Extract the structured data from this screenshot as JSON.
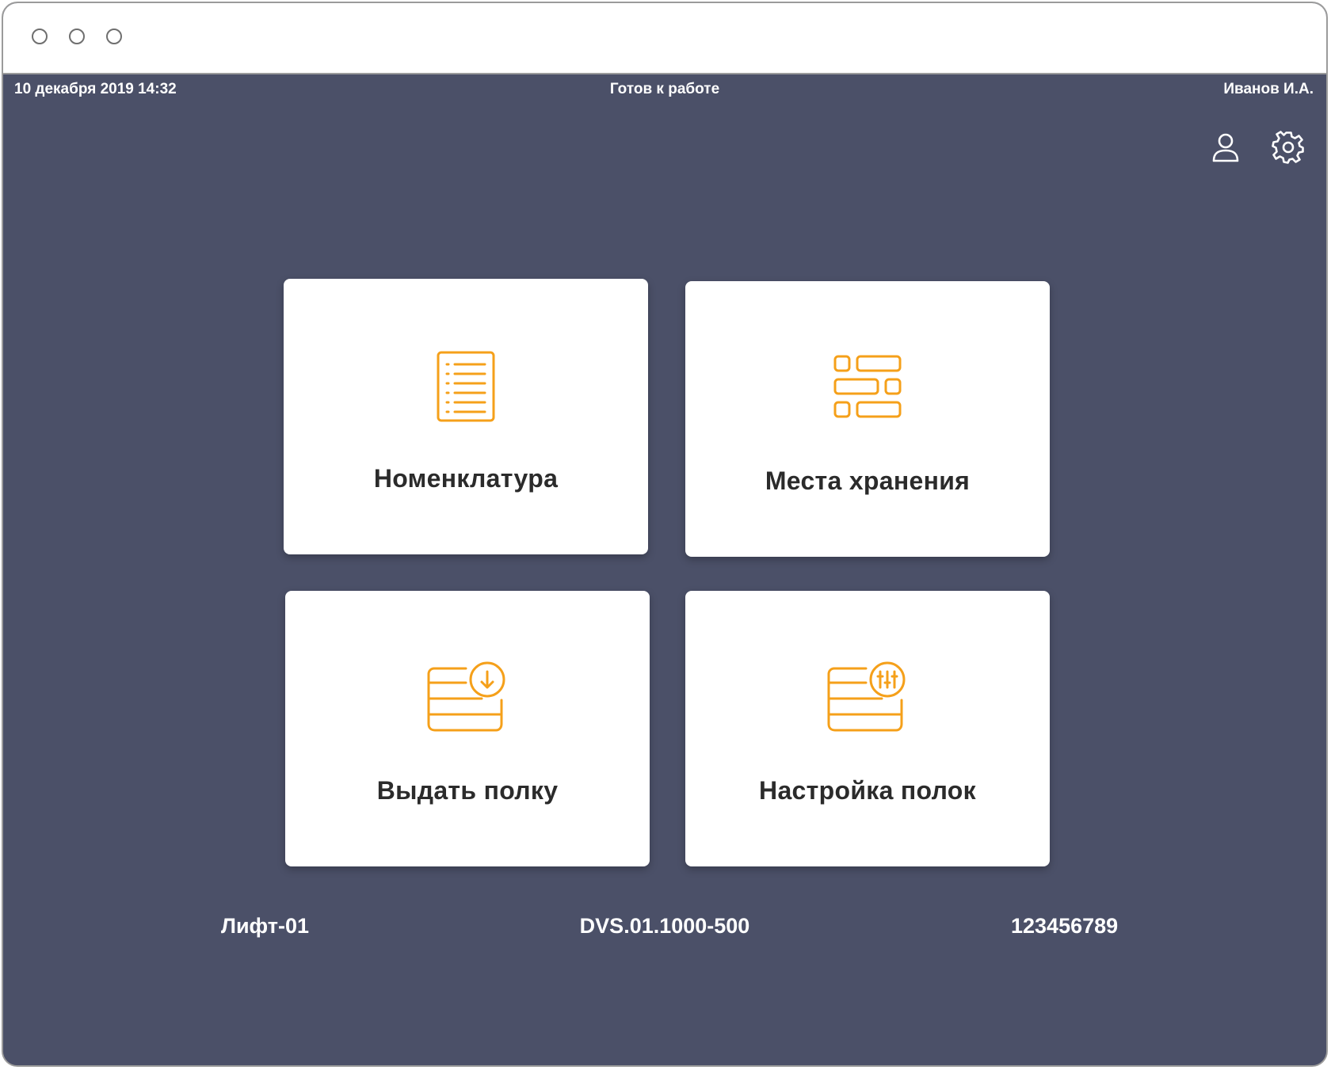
{
  "status": {
    "datetime": "10 декабря 2019 14:32",
    "state": "Готов к работе",
    "user": "Иванов И.А."
  },
  "toolbar": {
    "icons": [
      "user-icon",
      "gear-icon"
    ]
  },
  "tiles": [
    {
      "label": "Номенклатура",
      "icon": "list-document-icon"
    },
    {
      "label": "Места хранения",
      "icon": "storage-cells-icon"
    },
    {
      "label": "Выдать полку",
      "icon": "shelf-download-icon"
    },
    {
      "label": "Настройка полок",
      "icon": "shelf-settings-icon"
    }
  ],
  "footer": {
    "lift": "Лифт-01",
    "model": "DVS.01.1000-500",
    "serial": "123456789"
  },
  "colors": {
    "background": "#4b5068",
    "accent": "#f5a01a",
    "tile": "#ffffff",
    "tile_text": "#2b2b2b"
  }
}
